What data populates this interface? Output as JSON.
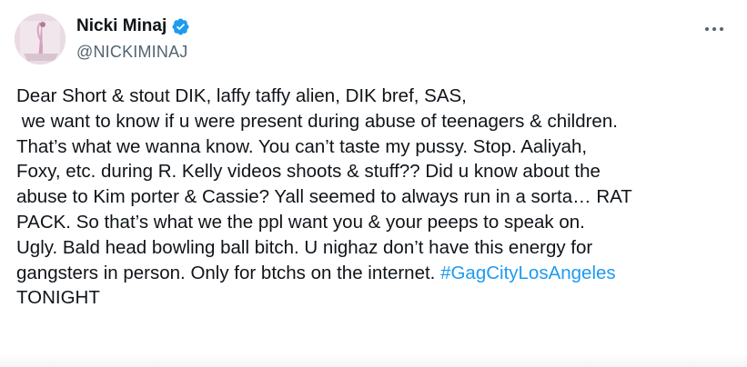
{
  "author": {
    "display_name": "Nicki Minaj",
    "handle": "@NICKIMINAJ",
    "verified_icon": "verified-badge-icon",
    "verified_color": "#1d9bf0"
  },
  "menu": {
    "icon": "more-options-icon"
  },
  "tweet": {
    "lines": [
      "Dear Short & stout DIK, laffy taffy alien, DIK bref, SAS,",
      " we want to know if u were present during abuse of teenagers & children.",
      "That’s what we wanna know. You can’t taste my pussy. Stop. Aaliyah,",
      "Foxy, etc. during R. Kelly videos shoots & stuff?? Did u know about the",
      "abuse to Kim porter & Cassie? Yall seemed to always run in a sorta… RAT",
      "PACK. So that’s what we the ppl want you & your peeps to speak on.",
      "Ugly. Bald head bowling ball bitch. U nighaz don’t have this energy for",
      "gangsters in person. Only for btchs on the internet. "
    ],
    "hashtag": "#GagCityLosAngeles",
    "hashtag_color": "#1d9bf0",
    "last_line": "TONIGHT"
  }
}
